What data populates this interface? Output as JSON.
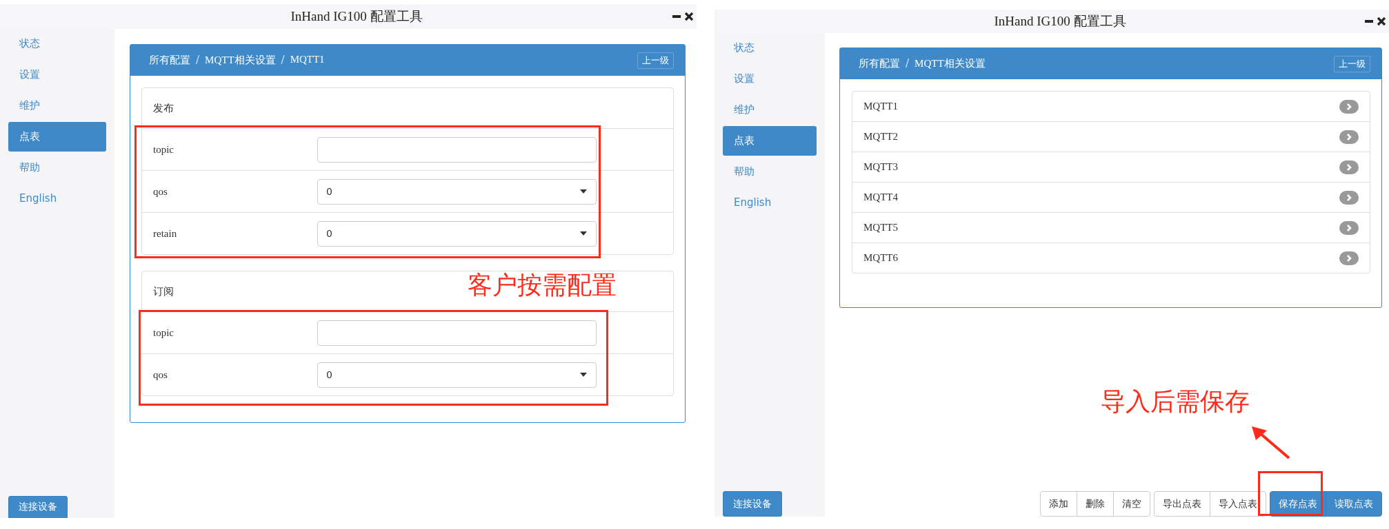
{
  "windows": [
    {
      "title": "InHand IG100 配置工具",
      "sidebar": {
        "items": [
          {
            "label": "状态",
            "selected": false
          },
          {
            "label": "设置",
            "selected": false
          },
          {
            "label": "维护",
            "selected": false
          },
          {
            "label": "点表",
            "selected": true
          },
          {
            "label": "帮助",
            "selected": false
          },
          {
            "label": "English",
            "selected": false
          }
        ],
        "connect_button": "连接设备"
      },
      "panel": {
        "breadcrumb": [
          "所有配置",
          "MQTT相关设置",
          "MQTT1"
        ],
        "separator": "/",
        "up_button": "上一级",
        "content": {
          "kind": "form",
          "sections": [
            {
              "title": "发布",
              "fields": [
                {
                  "label": "topic",
                  "kind": "text"
                },
                {
                  "label": "qos",
                  "kind": "select",
                  "value": "0"
                },
                {
                  "label": "retain",
                  "kind": "select",
                  "value": "0"
                }
              ]
            },
            {
              "title": "订阅",
              "fields": [
                {
                  "label": "topic",
                  "kind": "text"
                },
                {
                  "label": "qos",
                  "kind": "select",
                  "value": "0"
                }
              ]
            }
          ]
        }
      },
      "annotations": [
        {
          "kind": "box"
        },
        {
          "kind": "text",
          "text": "客户按需配置"
        },
        {
          "kind": "box"
        }
      ]
    },
    {
      "title": "InHand IG100 配置工具",
      "sidebar": {
        "items": [
          {
            "label": "状态",
            "selected": false
          },
          {
            "label": "设置",
            "selected": false
          },
          {
            "label": "维护",
            "selected": false
          },
          {
            "label": "点表",
            "selected": true
          },
          {
            "label": "帮助",
            "selected": false
          },
          {
            "label": "English",
            "selected": false
          }
        ],
        "connect_button": "连接设备"
      },
      "panel": {
        "breadcrumb": [
          "所有配置",
          "MQTT相关设置"
        ],
        "separator": "/",
        "up_button": "上一级",
        "content": {
          "kind": "list",
          "items": [
            "MQTT1",
            "MQTT2",
            "MQTT3",
            "MQTT4",
            "MQTT5",
            "MQTT6"
          ]
        }
      },
      "toolbar": [
        [
          {
            "label": "添加",
            "primary": false
          },
          {
            "label": "删除",
            "primary": false
          },
          {
            "label": "清空",
            "primary": false
          }
        ],
        [
          {
            "label": "导出点表",
            "primary": false
          },
          {
            "label": "导入点表",
            "primary": false
          }
        ],
        [
          {
            "label": "保存点表",
            "primary": true
          },
          {
            "label": "读取点表",
            "primary": true
          }
        ]
      ],
      "annotations": [
        {
          "kind": "text",
          "text": "导入后需保存"
        },
        {
          "kind": "arrow"
        },
        {
          "kind": "box"
        }
      ]
    }
  ]
}
